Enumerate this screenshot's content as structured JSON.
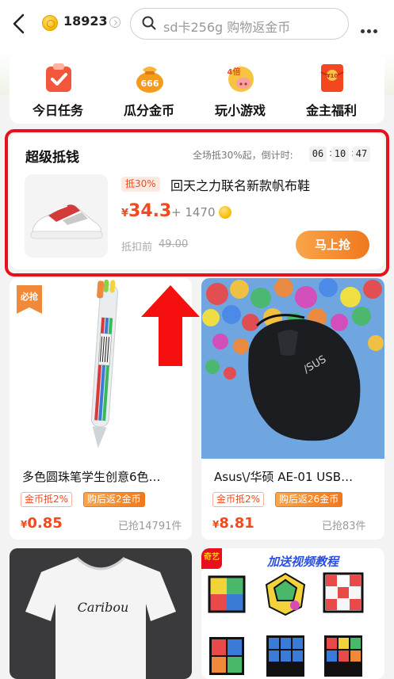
{
  "header": {
    "coin_count": "18923",
    "search_placeholder": "sd卡256g 购物返金币"
  },
  "tasks": [
    {
      "label": "今日任务",
      "icon": "clipboard-check-icon"
    },
    {
      "label": "瓜分金币",
      "icon": "coin-bag-icon",
      "badge": "666"
    },
    {
      "label": "玩小游戏",
      "icon": "game-pig-icon",
      "badge": "4倍"
    },
    {
      "label": "金主福利",
      "icon": "red-envelope-icon",
      "badge": "¥10"
    }
  ],
  "super": {
    "title": "超级抵钱",
    "subtitle": "全场抵30%起，倒计时:",
    "time": [
      "06",
      "10",
      "47"
    ],
    "deal": {
      "badge": "抵30%",
      "name": "回天之力联名新款帆布鞋",
      "price_symbol": "¥",
      "price": "34.3",
      "plus_coins": "+ 1470",
      "before_label": "抵扣前",
      "before_value": "49.00",
      "button": "马上抢"
    }
  },
  "products": [
    {
      "title": "多色圆珠笔学生创意6色…",
      "tag1": "金币抵2%",
      "tag2": "购后返2金币",
      "price_symbol": "¥",
      "price": "0.85",
      "sold": "已抢14791件",
      "badge": "必抢"
    },
    {
      "title": "Asus\\/华硕 AE-01 USB…",
      "tag1": "金币抵2%",
      "tag2": "购后返26金币",
      "price_symbol": "¥",
      "price": "8.81",
      "sold": "已抢83件"
    },
    {
      "title": "",
      "corner": "奇艺",
      "banner": "加送视频教程"
    }
  ],
  "colors": {
    "accent": "#f04a1e",
    "highlight_frame": "#e8101c",
    "button_gradient_start": "#f9a54a",
    "button_gradient_end": "#f0781d"
  }
}
